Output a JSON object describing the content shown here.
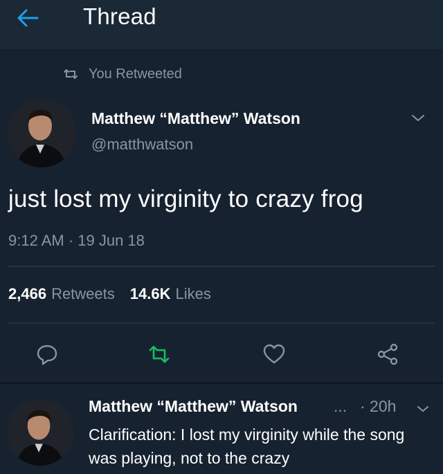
{
  "header": {
    "title": "Thread",
    "back_icon": "arrow-left-icon"
  },
  "retweet_context": {
    "icon": "retweet-icon",
    "label": "You Retweeted"
  },
  "tweet": {
    "author_name": "Matthew “Matthew” Watson",
    "author_handle": "@matthwatson",
    "text": "just lost my virginity to crazy frog",
    "timestamp": "9:12 AM · 19 Jun 18",
    "retweets_count": "2,466",
    "retweets_label": "Retweets",
    "likes_count": "14.6K",
    "likes_label": "Likes",
    "actions": [
      "reply-icon",
      "retweet-icon",
      "like-icon",
      "share-icon"
    ]
  },
  "reply": {
    "author_name": "Matthew “Matthew” Watson",
    "ellipsis": "...",
    "time": "· 20h",
    "text": "Clarification: I lost my virginity while the song was playing, not to the crazy"
  },
  "colors": {
    "background": "#172230",
    "header_background": "#1b2836",
    "muted_text": "#8796a5",
    "accent_blue": "#1da1f2",
    "retweet_green": "#17bf63",
    "divider": "#253341"
  }
}
